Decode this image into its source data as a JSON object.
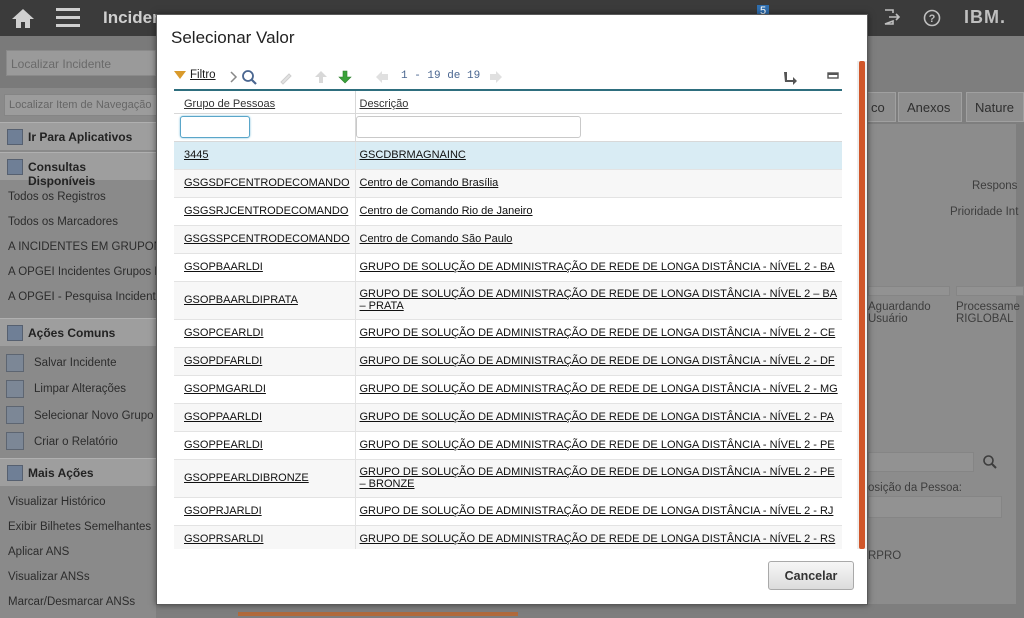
{
  "app": {
    "title_partial": "Inciden",
    "brand": "IBM.",
    "badge": "5"
  },
  "background": {
    "search_placeholder": "Localizar Incidente",
    "nav_search_placeholder": "Localizar Item de Navegação",
    "sections": {
      "goto": "Ir Para Aplicativos",
      "queries": "Consultas Disponíveis",
      "common": "Ações Comuns",
      "more": "Mais Ações"
    },
    "queries": [
      "Todos os Registros",
      "Todos os Marcadores",
      "A INCIDENTES EM GRUPON",
      "A OPGEI Incidentes Grupos N",
      "A OPGEI - Pesquisa Incidente"
    ],
    "common_actions": [
      "Salvar Incidente",
      "Limpar Alterações",
      "Selecionar Novo Grupo",
      "Criar o Relatório"
    ],
    "more_actions": [
      "Visualizar Histórico",
      "Exibir Bilhetes Semelhantes",
      "Aplicar ANS",
      "Visualizar ANSs",
      "Marcar/Desmarcar ANSs"
    ],
    "tabs": [
      "co",
      "Anexos",
      "Nature"
    ],
    "labels": {
      "respons": "Respons",
      "prioridade": "Prioridade Int",
      "aguardando": "Aguardando\nUsuário",
      "processam": "Processame\nRIGLOBAL",
      "posicao": "osição da Pessoa:",
      "rpro": "RPRO"
    }
  },
  "modal": {
    "title": "Selecionar Valor",
    "filter_label": "Filtro",
    "pager": "1 - 19 de 19",
    "columns": [
      "Grupo de Pessoas",
      "Descrição"
    ],
    "rows": [
      {
        "group": "3445",
        "desc": "GSCDBRMAGNAINC"
      },
      {
        "group": "GSGSDFCENTRODECOMANDO",
        "desc": "Centro de Comando Brasília"
      },
      {
        "group": "GSGSRJCENTRODECOMANDO",
        "desc": "Centro de Comando Rio de Janeiro"
      },
      {
        "group": "GSGSSPCENTRODECOMANDO",
        "desc": "Centro de Comando São Paulo"
      },
      {
        "group": "GSOPBAARLDI",
        "desc": "GRUPO DE SOLUÇÃO DE ADMINISTRAÇÃO DE REDE DE LONGA DISTÂNCIA - NÍVEL 2 - BA"
      },
      {
        "group": "GSOPBAARLDIPRATA",
        "desc": "GRUPO DE SOLUÇÃO DE ADMINISTRAÇÃO DE REDE DE LONGA DISTÂNCIA - NÍVEL 2 – BA – PRATA"
      },
      {
        "group": "GSOPCEARLDI",
        "desc": "GRUPO DE SOLUÇÃO DE ADMINISTRAÇÃO DE REDE DE LONGA DISTÂNCIA - NÍVEL 2 - CE"
      },
      {
        "group": "GSOPDFARLDI",
        "desc": "GRUPO DE SOLUÇÃO DE ADMINISTRAÇÃO DE REDE DE LONGA DISTÂNCIA - NÍVEL 2 - DF"
      },
      {
        "group": "GSOPMGARLDI",
        "desc": "GRUPO DE SOLUÇÃO DE ADMINISTRAÇÃO DE REDE DE LONGA DISTÂNCIA - NÍVEL 2 - MG"
      },
      {
        "group": "GSOPPAARLDI",
        "desc": "GRUPO DE SOLUÇÃO DE ADMINISTRAÇÃO DE REDE DE LONGA DISTÂNCIA - NÍVEL 2 - PA"
      },
      {
        "group": "GSOPPEARLDI",
        "desc": "GRUPO DE SOLUÇÃO DE ADMINISTRAÇÃO DE REDE DE LONGA DISTÂNCIA - NÍVEL 2 - PE"
      },
      {
        "group": "GSOPPEARLDIBRONZE",
        "desc": "GRUPO DE SOLUÇÃO DE ADMINISTRAÇÃO DE REDE DE LONGA DISTÂNCIA - NÍVEL 2 - PE – BRONZE"
      },
      {
        "group": "GSOPRJARLDI",
        "desc": "GRUPO DE SOLUÇÃO DE ADMINISTRAÇÃO DE REDE DE LONGA DISTÂNCIA - NÍVEL 2 - RJ"
      },
      {
        "group": "GSOPRSARLDI",
        "desc": "GRUPO DE SOLUÇÃO DE ADMINISTRAÇÃO DE REDE DE LONGA DISTÂNCIA - NÍVEL 2 - RS"
      }
    ],
    "cancel_label": "Cancelar",
    "colors": {
      "accent": "#2e6e7e",
      "selected_row": "#d9ecf4",
      "scrollbar": "#d0562a",
      "filter_icon": "#d99a2b",
      "next_arrow": "#3aa23a"
    }
  }
}
